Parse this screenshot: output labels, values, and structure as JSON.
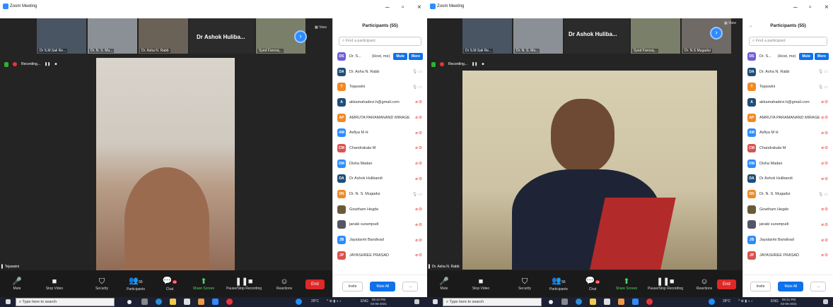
{
  "left": {
    "title": "Zoom Meeting",
    "thumbs": [
      "Dr S.M.Sali Re...",
      "Dr. N. S. Mu...",
      "Dr. Asha N. Rabb",
      "",
      "Syed Farooq..."
    ],
    "speaker": "Dr Ashok Huliba...",
    "view": "View",
    "recording": "Recording...",
    "nametag": "Tejaswini",
    "controls": [
      "Mute",
      "Stop Video",
      "Security",
      "Participants",
      "Chat",
      "Share Screen",
      "Pause/Stop Recording",
      "Reactions"
    ],
    "participants_count": "55",
    "chat_badge": "28",
    "end": "End",
    "panel_title": "Participants (55)",
    "search_placeholder": "Find a participant",
    "participants": [
      {
        "init": "DS",
        "name": "Dr. S...",
        "tag": "(Host, me)",
        "color": "#6d5fd6"
      },
      {
        "init": "DA",
        "name": "Dr. Asha N. Rabb",
        "color": "#1f4e79"
      },
      {
        "init": "T",
        "name": "Tejaswini",
        "color": "#f08a24"
      },
      {
        "init": "A",
        "name": "akkamahadevi.h@gmail.com",
        "color": "#1f4e79"
      },
      {
        "init": "AP",
        "name": "AMRUTA PARAMANAND MIRAGE",
        "color": "#f08a24"
      },
      {
        "init": "AM",
        "name": "Asfiya M H",
        "color": "#2d8cff"
      },
      {
        "init": "CM",
        "name": "Chandrakala M",
        "color": "#d9534f"
      },
      {
        "init": "DM",
        "name": "Disha Madan",
        "color": "#2d8cff"
      },
      {
        "init": "DA",
        "name": "Dr Ashok Hulibandi",
        "color": "#1f4e79"
      },
      {
        "init": "DN",
        "name": "Dr. N. S. Mugadur",
        "color": "#f08a24"
      },
      {
        "init": "",
        "name": "Gowtham Hegde",
        "color": "#6b5a3a"
      },
      {
        "init": "",
        "name": "janaki surampudi",
        "color": "#556"
      },
      {
        "init": "JB",
        "name": "Jayalaxmi Bandivad",
        "color": "#2d8cff"
      },
      {
        "init": "JP",
        "name": "JAYASHREE PRASAD",
        "color": "#d9534f"
      }
    ],
    "mute_label": "Mute",
    "more_label": "More",
    "invite": "Invite",
    "mute_all": "Mute All",
    "ellipsis": "..."
  },
  "right": {
    "title": "Zoom Meeting",
    "thumbs": [
      "Dr S.M.Sali Re...",
      "Dr. N. S. Mu...",
      "",
      "Syed Farooq...",
      "Dr. N.S Mugadur"
    ],
    "speaker": "Dr Ashok Huliba...",
    "view": "View",
    "recording": "Recording...",
    "nametag": "Dr. Asha N. Rabb",
    "end": "End",
    "panel_title": "Participants (55)",
    "search_placeholder": "Find a participant"
  },
  "taskbar": {
    "search": "Type here to search",
    "temp": "28°C",
    "lang": "ENG",
    "time_left": "05:42 PM",
    "date_left": "03-06-2021",
    "time_right": "05:41 PM",
    "date_right": "03-06-2021"
  }
}
